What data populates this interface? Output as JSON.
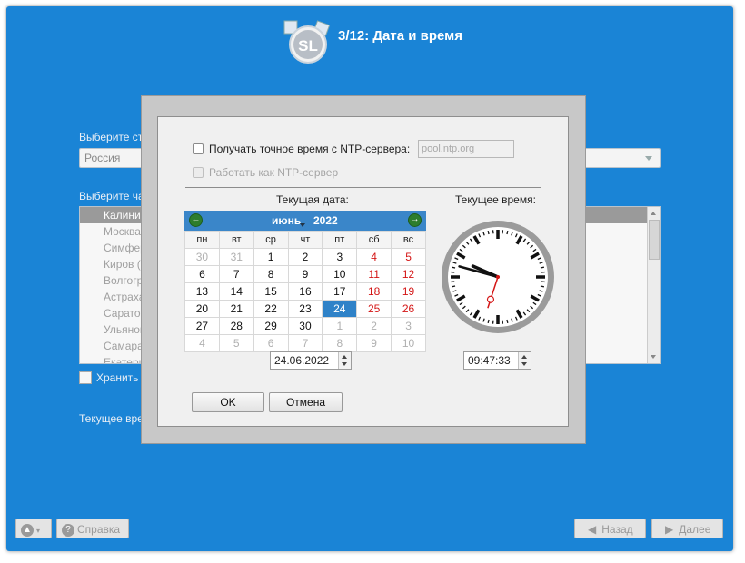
{
  "header": {
    "title": "3/12: Дата и время"
  },
  "background": {
    "select_country_label": "Выберите стр",
    "country_value": "Россия",
    "select_timezone_label": "Выберите ча",
    "timezones": [
      "Калинин",
      "Москва (",
      "Симферо",
      "Киров (+",
      "Волгогра",
      "Астрахан",
      "Саратов",
      "Ульянов",
      "Самара",
      "Екатери"
    ],
    "keep_label": "Хранить в",
    "current_time_label": "Текущее врем"
  },
  "footer": {
    "help_label": "Справка",
    "back_label": "Назад",
    "next_label": "Далее"
  },
  "dialog": {
    "ntp_checkbox_label": "Получать точное время с NTP-сервера:",
    "ntp_server_placeholder": "pool.ntp.org",
    "ntp_server_mode_label": "Работать как NTP-сервер",
    "current_date_label": "Текущая дата:",
    "current_time_label": "Текущее время:",
    "calendar": {
      "month": "июнь",
      "year": "2022",
      "weekdays": [
        "пн",
        "вт",
        "ср",
        "чт",
        "пт",
        "сб",
        "вс"
      ],
      "weeks": [
        [
          "30",
          "31",
          "1",
          "2",
          "3",
          "4",
          "5"
        ],
        [
          "6",
          "7",
          "8",
          "9",
          "10",
          "11",
          "12"
        ],
        [
          "13",
          "14",
          "15",
          "16",
          "17",
          "18",
          "19"
        ],
        [
          "20",
          "21",
          "22",
          "23",
          "24",
          "25",
          "26"
        ],
        [
          "27",
          "28",
          "29",
          "30",
          "1",
          "2",
          "3"
        ],
        [
          "4",
          "5",
          "6",
          "7",
          "8",
          "9",
          "10"
        ]
      ],
      "selected_day": "24"
    },
    "date_value": "24.06.2022",
    "time_value": "09:47:33",
    "ok_label": "OK",
    "cancel_label": "Отмена"
  },
  "colors": {
    "window_bg": "#1a84d6",
    "calendar_header": "#3a86c9",
    "weekend": "#d41515",
    "selected": "#2f82c8",
    "second_hand": "#d41515"
  }
}
